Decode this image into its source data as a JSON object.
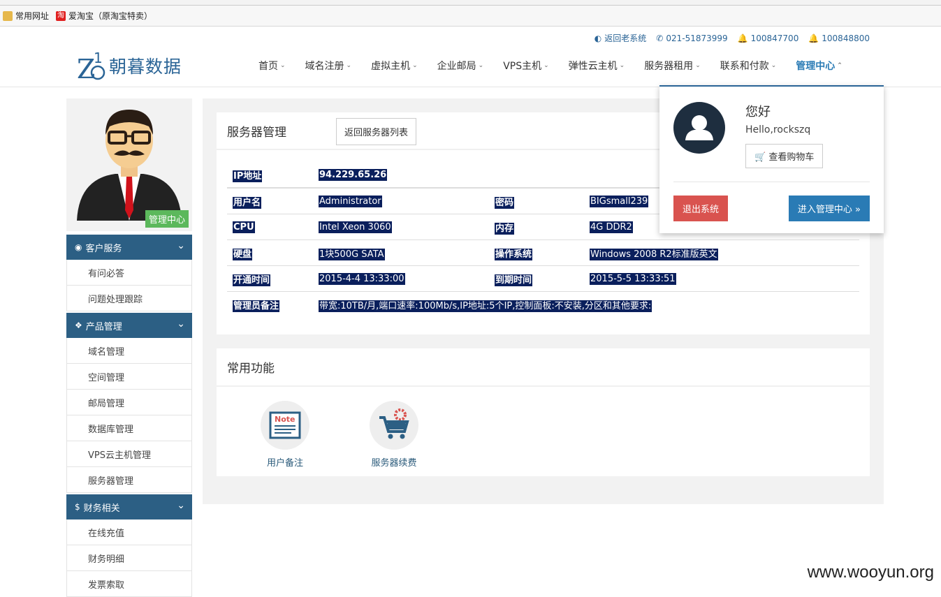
{
  "bookmarks": [
    {
      "label": "常用网址",
      "icon": "folder-icon"
    },
    {
      "label": "爱淘宝（原淘宝特卖）",
      "icon": "taobao-icon"
    }
  ],
  "topbar": {
    "old_system": "返回老系统",
    "phone": "021-51873999",
    "qq1": "100847700",
    "qq2": "100848800"
  },
  "logo": {
    "text": "朝暮数据"
  },
  "nav": [
    {
      "label": "首页"
    },
    {
      "label": "域名注册"
    },
    {
      "label": "虚拟主机"
    },
    {
      "label": "企业邮局"
    },
    {
      "label": "VPS主机"
    },
    {
      "label": "弹性云主机"
    },
    {
      "label": "服务器租用"
    },
    {
      "label": "联系和付款"
    },
    {
      "label": "管理中心"
    }
  ],
  "sidebar": {
    "badge": "管理中心",
    "sections": [
      {
        "title": "客户服务",
        "icon": "dashboard-icon",
        "items": [
          "有问必答",
          "问题处理跟踪"
        ]
      },
      {
        "title": "产品管理",
        "icon": "cubes-icon",
        "items": [
          "域名管理",
          "空间管理",
          "邮局管理",
          "数据库管理",
          "VPS云主机管理",
          "服务器管理"
        ]
      },
      {
        "title": "财务相关",
        "icon": "dollar-icon",
        "items": [
          "在线充值",
          "财务明细",
          "发票索取"
        ]
      }
    ]
  },
  "server": {
    "title": "服务器管理",
    "back_button": "返回服务器列表",
    "ip_label": "IP地址",
    "ip": "94.229.65.26",
    "rows": [
      {
        "k1": "用户名",
        "v1": "Administrator",
        "k2": "密码",
        "v2": "BIGsmall239"
      },
      {
        "k1": "CPU",
        "v1": "Intel Xeon 3060",
        "k2": "内存",
        "v2": "4G DDR2"
      },
      {
        "k1": "硬盘",
        "v1": "1块500G SATA",
        "k2": "操作系统",
        "v2": "Windows 2008 R2标准版英文"
      },
      {
        "k1": "开通时间",
        "v1": "2015-4-4 13:33:00",
        "k2": "到期时间",
        "v2": "2015-5-5 13:33:51"
      }
    ],
    "note_label": "管理员备注",
    "note": "带宽:10TB/月,端口速率:100Mb/s,IP地址:5个IP,控制面板:不安装,分区和其他要求:"
  },
  "functions": {
    "title": "常用功能",
    "items": [
      {
        "label": "用户备注",
        "icon": "note-icon",
        "icon_text": "Note"
      },
      {
        "label": "服务器续费",
        "icon": "cart-gear-icon"
      }
    ]
  },
  "dropdown": {
    "hello": "您好",
    "user": "Hello,rockszq",
    "cart": "查看购物车",
    "logout": "退出系统",
    "enter": "进入管理中心 »"
  },
  "watermark": "www.wooyun.org",
  "colors": {
    "brand": "#2a6496",
    "sidebar_head": "#2c5f84",
    "logout": "#d9534f",
    "enter": "#2a7bb5",
    "badge": "#5cb85c"
  }
}
